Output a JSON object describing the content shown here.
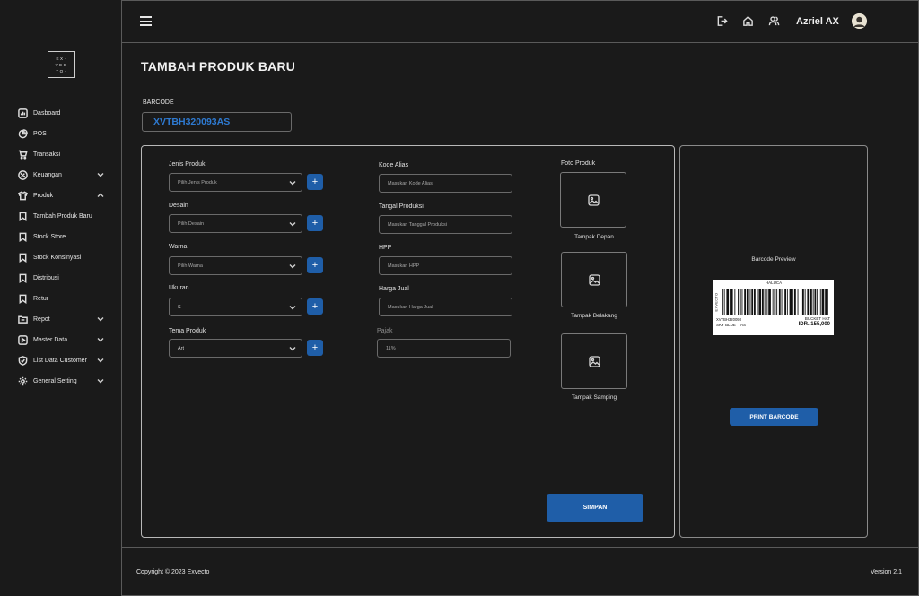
{
  "logo": {
    "line1": "EX·",
    "line2": "VEC",
    "line3": "TO·"
  },
  "sidebar": {
    "items": [
      {
        "label": "Dasboard",
        "icon": "dashboard-icon",
        "expandable": false
      },
      {
        "label": "POS",
        "icon": "pie-chart-icon",
        "expandable": false
      },
      {
        "label": "Transaksi",
        "icon": "cart-icon",
        "expandable": false
      },
      {
        "label": "Keuangan",
        "icon": "percent-icon",
        "expandable": true,
        "expanded": false
      },
      {
        "label": "Produk",
        "icon": "shirt-icon",
        "expandable": true,
        "expanded": true
      },
      {
        "label": "Tambah Produk Baru",
        "icon": "bookmark-icon",
        "expandable": false
      },
      {
        "label": "Stock Store",
        "icon": "bookmark-icon",
        "expandable": false
      },
      {
        "label": "Stock Konsinyasi",
        "icon": "bookmark-icon",
        "expandable": false
      },
      {
        "label": "Distribusi",
        "icon": "bookmark-icon",
        "expandable": false
      },
      {
        "label": "Retur",
        "icon": "bookmark-icon",
        "expandable": false
      },
      {
        "label": "Repot",
        "icon": "folder-icon",
        "expandable": true,
        "expanded": false
      },
      {
        "label": "Master Data",
        "icon": "play-square-icon",
        "expandable": true,
        "expanded": false
      },
      {
        "label": "List Data Customer",
        "icon": "shield-check-icon",
        "expandable": true,
        "expanded": false
      },
      {
        "label": "General Setting",
        "icon": "gear-icon",
        "expandable": true,
        "expanded": false
      }
    ]
  },
  "header": {
    "username": "Azriel AX"
  },
  "page": {
    "title": "TAMBAH PRODUK BARU"
  },
  "barcode": {
    "label": "BARCODE",
    "value": "XVTBH320093AS"
  },
  "form": {
    "left": [
      {
        "label": "Jenis Produk",
        "placeholder": "Pilih Jenis Produk",
        "selected": false
      },
      {
        "label": "Desain",
        "placeholder": "Pilih Desain",
        "selected": false
      },
      {
        "label": "Warna",
        "placeholder": "Pilih Warna",
        "selected": false
      },
      {
        "label": "Ukuran",
        "placeholder": "S",
        "selected": true
      },
      {
        "label": "Tema Produk",
        "placeholder": "Art",
        "selected": true
      }
    ],
    "add_label": "+",
    "middle": [
      {
        "label": "Kode Alias",
        "placeholder": "Masukan Kode Alias"
      },
      {
        "label": "Tangal Produksi",
        "placeholder": "Masukan Tanggal Produksi"
      },
      {
        "label": "HPP",
        "placeholder": "Masukan HPP"
      },
      {
        "label": "Harga Jual",
        "placeholder": "Masukan Harga Jual"
      },
      {
        "label": "Pajak",
        "placeholder": "11%"
      }
    ],
    "photos_label": "Foto Produk",
    "photos": [
      {
        "caption": "Tampak Depan"
      },
      {
        "caption": "Tampak Belakang"
      },
      {
        "caption": "Tampak Samping"
      }
    ],
    "save_label": "SIMPAN"
  },
  "preview": {
    "title": "Barcode Preview",
    "label": {
      "brand": "HALUCA",
      "vertical": "EXVECTO",
      "code": "XVTBH320093",
      "color": "SKY BLUE",
      "size": "AS",
      "product": "BUCKET HAT",
      "price": "IDR. 155,000"
    },
    "print_label": "PRINT BARCODE"
  },
  "footer": {
    "copyright": "Copyright © 2023 Exvecto",
    "version": "Version 2.1"
  },
  "colors": {
    "accent": "#1f5ea8",
    "barcode_text": "#2e7ad1",
    "background": "#1a1a1a"
  }
}
